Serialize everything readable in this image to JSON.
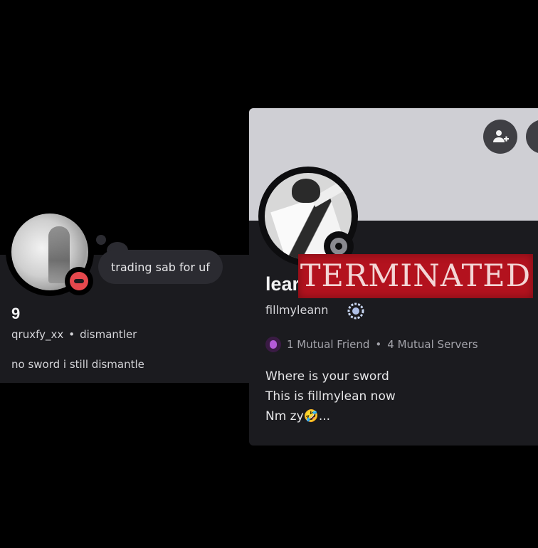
{
  "left_profile": {
    "status_text": "trading sab for uf",
    "display_name": "9",
    "username": "qruxfy_xx",
    "separator": "•",
    "pronouns": "dismantler",
    "bio": "no sword i still dismantle",
    "status_icon": "do-not-disturb-icon"
  },
  "right_profile": {
    "display_name": "lear",
    "overlay_text": "TERMINATED",
    "username": "fillmyleann",
    "badge_icon": "badge-icon",
    "mutual_friends": "1 Mutual Friend",
    "separator": "•",
    "mutual_servers": "4 Mutual Servers",
    "bio_lines": [
      "Where is your sword",
      "This is fillmylean now",
      "Nm zy🤣..."
    ],
    "status_icon": "offline-status-icon",
    "action_icons": [
      "add-friend-icon",
      "more-options-icon"
    ]
  },
  "colors": {
    "background": "#000000",
    "card": "#1b1b1f",
    "banner": "#cfcfd4",
    "dnd_red": "#e5484d",
    "terminated_red": "#b3121e"
  }
}
